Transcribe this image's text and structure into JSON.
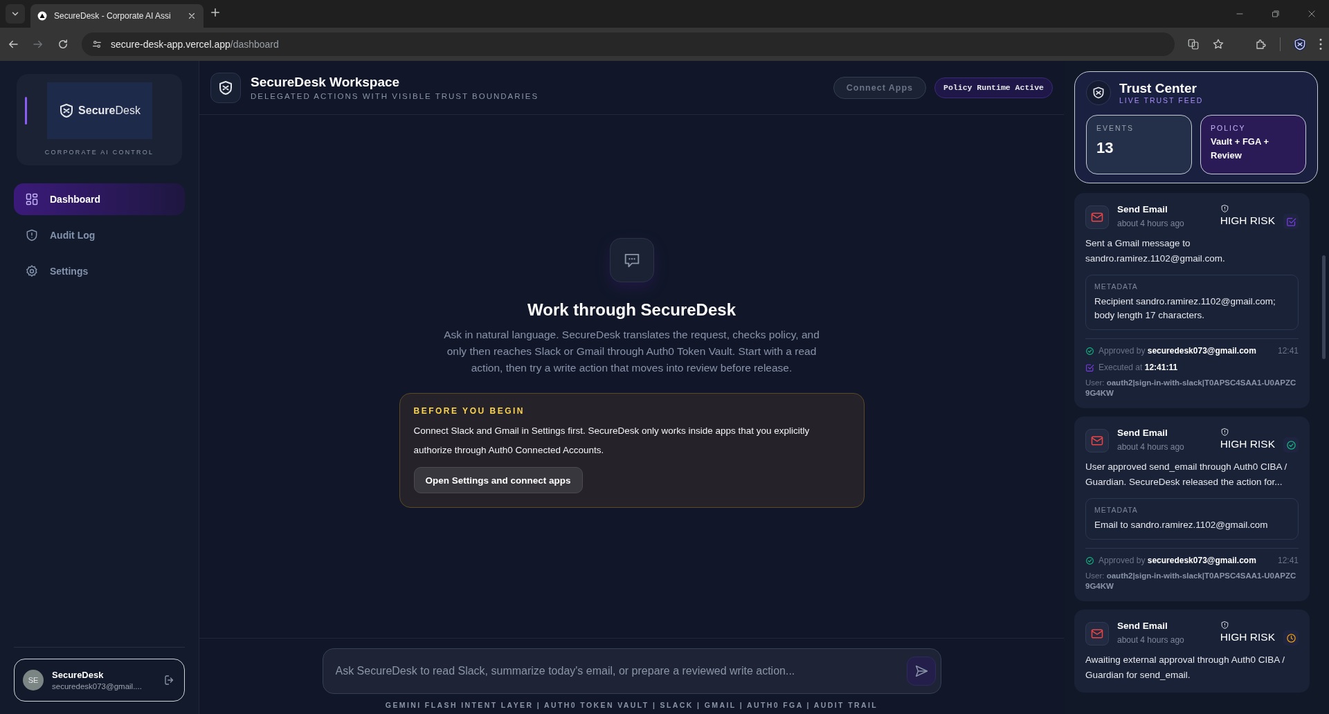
{
  "browser": {
    "tab_title": "SecureDesk - Corporate AI Assi",
    "url_host": "secure-desk-app.vercel.app",
    "url_path": "/dashboard"
  },
  "sidebar": {
    "logo_text_bold": "Secure",
    "logo_text": "Desk",
    "tagline": "CORPORATE AI CONTROL",
    "items": [
      {
        "label": "Dashboard",
        "selected": true
      },
      {
        "label": "Audit Log",
        "selected": false
      },
      {
        "label": "Settings",
        "selected": false
      }
    ],
    "user": {
      "initials": "SE",
      "name": "SecureDesk",
      "email": "securedesk073@gmail...."
    }
  },
  "header": {
    "title": "SecureDesk Workspace",
    "subtitle": "DELEGATED ACTIONS WITH VISIBLE TRUST BOUNDARIES",
    "connect_button": "Connect Apps",
    "policy_badge": "Policy Runtime Active"
  },
  "empty_state": {
    "title": "Work through SecureDesk",
    "text": "Ask in natural language. SecureDesk translates the request, checks policy, and only then reaches Slack or Gmail through Auth0 Token Vault. Start with a read action, then try a write action that moves into review before release."
  },
  "notice": {
    "heading": "BEFORE YOU BEGIN",
    "text": "Connect Slack and Gmail in Settings first. SecureDesk only works inside apps that you explicitly authorize through Auth0 Connected Accounts.",
    "button": "Open Settings and connect apps"
  },
  "composer": {
    "placeholder": "Ask SecureDesk to read Slack, summarize today's email, or prepare a reviewed write action...",
    "footer": "GEMINI FLASH INTENT LAYER | AUTH0 TOKEN VAULT | SLACK | GMAIL | AUTH0 FGA | AUDIT TRAIL"
  },
  "trust_center": {
    "title": "Trust Center",
    "subtitle": "LIVE TRUST FEED",
    "events_label": "EVENTS",
    "events_value": "13",
    "policy_label": "POLICY",
    "policy_value": "Vault + FGA + Review"
  },
  "events": [
    {
      "title": "Send Email",
      "time": "about 4 hours ago",
      "risk": "HIGH RISK",
      "kind": "executed",
      "description": "Sent a Gmail message to sandro.ramirez.1102@gmail.com.",
      "metadata_label": "METADATA",
      "metadata": "Recipient sandro.ramirez.1102@gmail.com; body length 17 characters.",
      "approval": {
        "label": "Approved by",
        "who": "securedesk073@gmail.com",
        "time": "12:41"
      },
      "executed": {
        "label": "Executed at",
        "time": "12:41:11"
      },
      "user": {
        "label": "User:",
        "value": "oauth2|sign-in-with-slack|T0APSC4SAA1-U0APZC9G4KW"
      }
    },
    {
      "title": "Send Email",
      "time": "about 4 hours ago",
      "risk": "HIGH RISK",
      "kind": "approved",
      "description": "User approved send_email through Auth0 CIBA / Guardian. SecureDesk released the action for...",
      "metadata_label": "METADATA",
      "metadata": "Email to sandro.ramirez.1102@gmail.com",
      "approval": {
        "label": "Approved by",
        "who": "securedesk073@gmail.com",
        "time": "12:41"
      },
      "user": {
        "label": "User:",
        "value": "oauth2|sign-in-with-slack|T0APSC4SAA1-U0APZC9G4KW"
      }
    },
    {
      "title": "Send Email",
      "time": "about 4 hours ago",
      "risk": "HIGH RISK",
      "kind": "pending",
      "description": "Awaiting external approval through Auth0 CIBA / Guardian for send_email."
    }
  ]
}
